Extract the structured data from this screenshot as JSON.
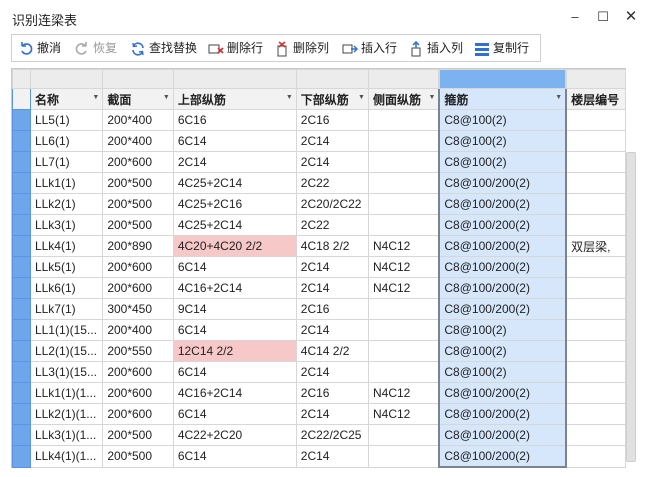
{
  "window": {
    "title": "识别连梁表"
  },
  "toolbar": {
    "undo": "撤消",
    "redo": "恢复",
    "find_replace": "查找替换",
    "delete_row": "删除行",
    "delete_col": "删除列",
    "insert_row": "插入行",
    "insert_col": "插入列",
    "copy_row": "复制行"
  },
  "table": {
    "headers": [
      "名称",
      "截面",
      "上部纵筋",
      "下部纵筋",
      "侧面纵筋",
      "箍筋",
      "楼层编号"
    ],
    "rows": [
      [
        "LL5(1)",
        "200*400",
        "6C16",
        "2C16",
        "",
        "C8@100(2)",
        ""
      ],
      [
        "LL6(1)",
        "200*400",
        "6C14",
        "2C14",
        "",
        "C8@100(2)",
        ""
      ],
      [
        "LL7(1)",
        "200*600",
        "2C14",
        "2C14",
        "",
        "C8@100(2)",
        ""
      ],
      [
        "LLk1(1)",
        "200*500",
        "4C25+2C14",
        "2C22",
        "",
        "C8@100/200(2)",
        ""
      ],
      [
        "LLk2(1)",
        "200*500",
        "4C25+2C16",
        "2C20/2C22",
        "",
        "C8@100/200(2)",
        ""
      ],
      [
        "LLk3(1)",
        "200*500",
        "4C25+2C14",
        "2C22",
        "",
        "C8@100/200(2)",
        ""
      ],
      [
        "LLk4(1)",
        "200*890",
        "4C20+4C20 2/2",
        "4C18 2/2",
        "N4C12",
        "C8@100/200(2)",
        "双层梁,"
      ],
      [
        "LLk5(1)",
        "200*600",
        "6C14",
        "2C14",
        "N4C12",
        "C8@100/200(2)",
        ""
      ],
      [
        "LLk6(1)",
        "200*600",
        "4C16+2C14",
        "2C14",
        "N4C12",
        "C8@100/200(2)",
        ""
      ],
      [
        "LLk7(1)",
        "300*450",
        "9C14",
        "2C16",
        "",
        "C8@100/200(2)",
        ""
      ],
      [
        "LL1(1)(15...",
        "200*400",
        "6C14",
        "2C14",
        "",
        "C8@100(2)",
        ""
      ],
      [
        "LL2(1)(15...",
        "200*550",
        "12C14 2/2",
        "4C14 2/2",
        "",
        "C8@100(2)",
        ""
      ],
      [
        "LL3(1)(15...",
        "200*600",
        "6C14",
        "2C14",
        "",
        "C8@100(2)",
        ""
      ],
      [
        "LLk1(1)(1...",
        "200*600",
        "4C16+2C14",
        "2C16",
        "N4C12",
        "C8@100/200(2)",
        ""
      ],
      [
        "LLk2(1)(1...",
        "200*600",
        "6C14",
        "2C14",
        "N4C12",
        "C8@100/200(2)",
        ""
      ],
      [
        "LLk3(1)(1...",
        "200*500",
        "4C22+2C20",
        "2C22/2C25",
        "",
        "C8@100/200(2)",
        ""
      ],
      [
        "LLk4(1)(1...",
        "200*500",
        "6C14",
        "2C14",
        "",
        "C8@100/200(2)",
        ""
      ]
    ],
    "warn_cells": [
      [
        6,
        2
      ],
      [
        11,
        2
      ]
    ],
    "selected_column": 5
  },
  "colors": {
    "selection": "#6ea6ec",
    "selected_column_fill": "#d6e7fb",
    "warning_fill": "#f7c8c8"
  }
}
